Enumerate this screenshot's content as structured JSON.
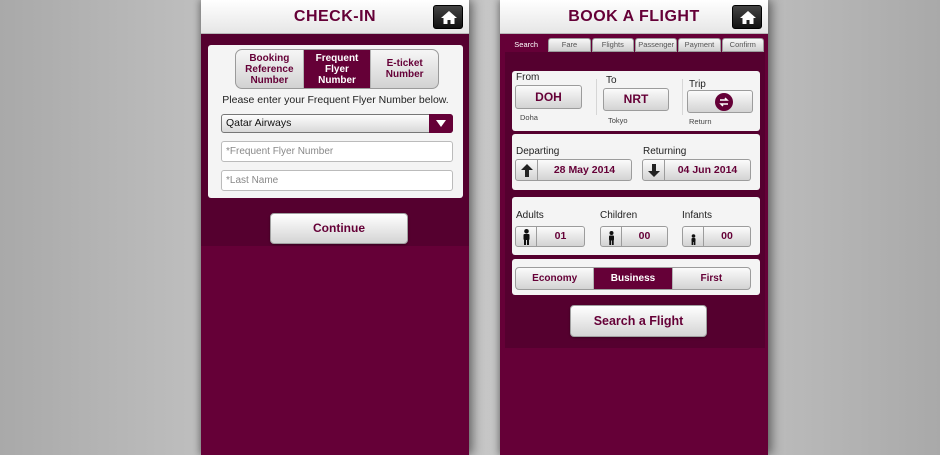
{
  "checkin": {
    "title": "CHECK-IN",
    "segments": [
      {
        "label": "Booking Reference Number",
        "active": false
      },
      {
        "label": "Frequent Flyer Number",
        "active": true
      },
      {
        "label": "E-ticket Number",
        "active": false
      }
    ],
    "instruction": "Please enter your Frequent Flyer Number below.",
    "airline_select": "Qatar Airways",
    "ffn_placeholder": "*Frequent Flyer Number",
    "lastname_placeholder": "*Last Name",
    "continue_label": "Continue"
  },
  "book": {
    "title": "BOOK A FLIGHT",
    "tabs": [
      {
        "label": "Search",
        "active": true
      },
      {
        "label": "Fare",
        "active": false
      },
      {
        "label": "Flights",
        "active": false
      },
      {
        "label": "Passenger",
        "active": false
      },
      {
        "label": "Payment",
        "active": false
      },
      {
        "label": "Confirm",
        "active": false
      }
    ],
    "from": {
      "label": "From",
      "code": "DOH",
      "city": "Doha"
    },
    "to": {
      "label": "To",
      "code": "NRT",
      "city": "Tokyo"
    },
    "trip": {
      "label": "Trip",
      "value": "Return",
      "icon": "return-trip-icon"
    },
    "departing": {
      "label": "Departing",
      "date": "28 May 2014",
      "icon": "arrow-up-icon"
    },
    "returning": {
      "label": "Returning",
      "date": "04 Jun 2014",
      "icon": "arrow-down-icon"
    },
    "adults": {
      "label": "Adults",
      "count": "01",
      "icon": "adult-icon"
    },
    "children": {
      "label": "Children",
      "count": "00",
      "icon": "child-icon"
    },
    "infants": {
      "label": "Infants",
      "count": "00",
      "icon": "infant-icon"
    },
    "classes": [
      {
        "label": "Economy",
        "active": false
      },
      {
        "label": "Business",
        "active": true
      },
      {
        "label": "First",
        "active": false
      }
    ],
    "search_label": "Search a Flight"
  },
  "colors": {
    "brand": "#650037",
    "brand_dark": "#55002f",
    "background": "#c0c0c0"
  }
}
